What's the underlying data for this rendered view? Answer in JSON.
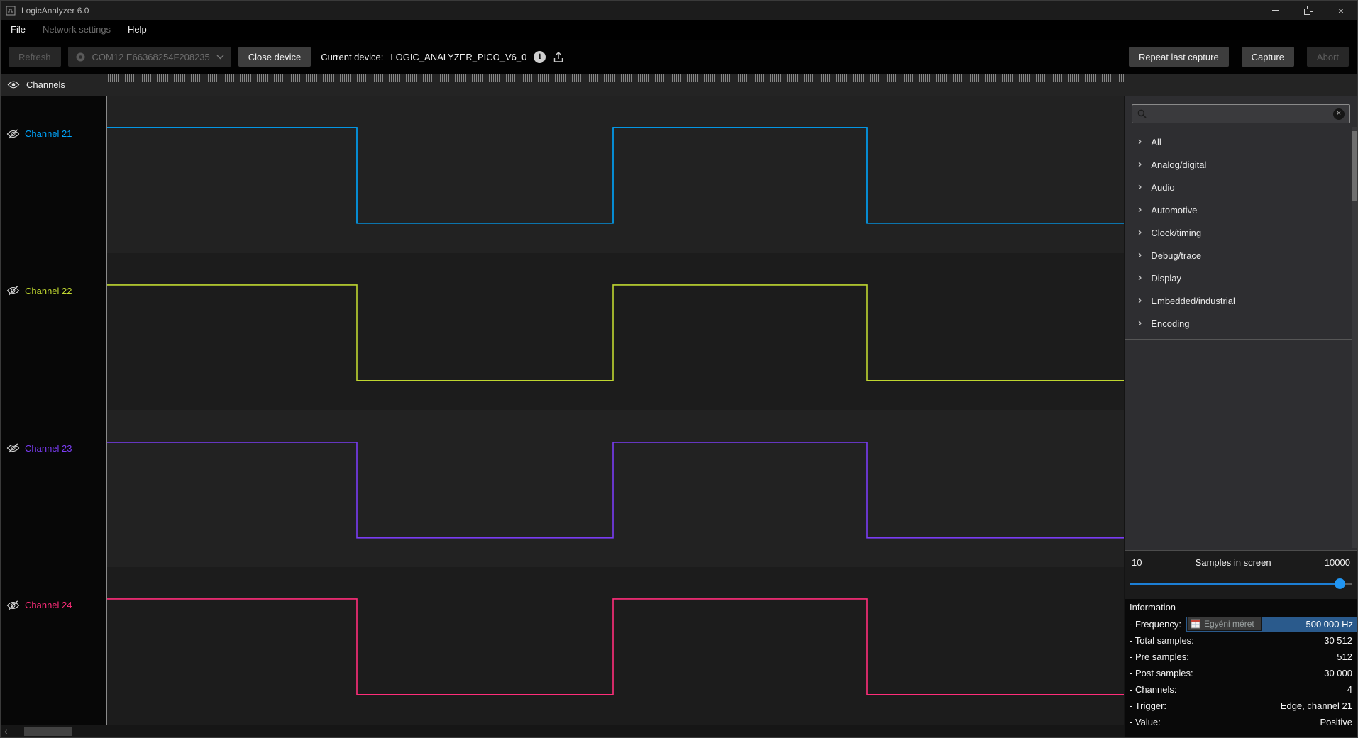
{
  "window": {
    "title": "LogicAnalyzer 6.0"
  },
  "menu": {
    "items": [
      {
        "label": "File",
        "enabled": true
      },
      {
        "label": "Network settings",
        "enabled": false
      },
      {
        "label": "Help",
        "enabled": true
      }
    ]
  },
  "toolbar": {
    "refresh": "Refresh",
    "device_combo": "COM12 E66368254F208235",
    "close_device": "Close device",
    "current_device_label": "Current device:",
    "current_device_value": "LOGIC_ANALYZER_PICO_V6_0",
    "repeat_last_capture": "Repeat last capture",
    "capture": "Capture",
    "abort": "Abort"
  },
  "channels_header": {
    "label": "Channels"
  },
  "channels": [
    {
      "label": "Channel 21",
      "color": "#00a6ff"
    },
    {
      "label": "Channel 22",
      "color": "#bfd630"
    },
    {
      "label": "Channel 23",
      "color": "#7a3cf4"
    },
    {
      "label": "Channel 24",
      "color": "#ff2d7a"
    }
  ],
  "waveform": {
    "start_high": true,
    "transitions": [
      0.247,
      0.498,
      0.748
    ]
  },
  "sidebar": {
    "search": {
      "placeholder": "",
      "value": ""
    },
    "tree_items": [
      "All",
      "Analog/digital",
      "Audio",
      "Automotive",
      "Clock/timing",
      "Debug/trace",
      "Display",
      "Embedded/industrial",
      "Encoding"
    ],
    "slider": {
      "min": "10",
      "title": "Samples in screen",
      "max": "10000"
    },
    "information": {
      "title": "Information",
      "frequency": {
        "label": "- Frequency:",
        "tooltip": "Egyéni méret",
        "value": "500 000 Hz"
      },
      "rows": [
        {
          "label": "- Total samples:",
          "value": "30 512"
        },
        {
          "label": "- Pre samples:",
          "value": "512"
        },
        {
          "label": "- Post samples:",
          "value": "30 000"
        },
        {
          "label": "- Channels:",
          "value": "4"
        },
        {
          "label": "- Trigger:",
          "value": "Edge, channel 21"
        },
        {
          "label": "- Value:",
          "value": "Positive"
        }
      ]
    }
  },
  "icons": {
    "close": "×",
    "clear": "×",
    "info": "i",
    "tree_chevron": "›",
    "scroll_left": "‹"
  }
}
